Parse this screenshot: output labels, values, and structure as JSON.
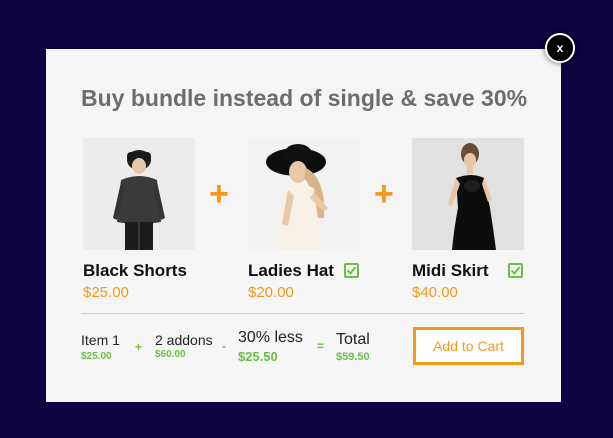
{
  "close_label": "x",
  "title": "Buy bundle instead of single & save 30%",
  "products": [
    {
      "name": "Black Shorts",
      "price": "$25.00",
      "checked": false
    },
    {
      "name": "Ladies Hat",
      "price": "$20.00",
      "checked": true
    },
    {
      "name": "Midi Skirt",
      "price": "$40.00",
      "checked": true
    }
  ],
  "plus_symbol": "+",
  "summary": {
    "item": {
      "label": "Item 1",
      "value": "$25.00"
    },
    "op1": "+",
    "addons": {
      "label": "2 addons",
      "value": "$60.00"
    },
    "op2": "-",
    "discount": {
      "label": "30% less",
      "value": "$25.50"
    },
    "op3": "=",
    "total": {
      "label": "Total",
      "value": "$59.50"
    }
  },
  "add_to_cart_label": "Add to Cart",
  "colors": {
    "accent": "#f39a1d",
    "green": "#6cc04a",
    "backdrop": "#0c0540"
  },
  "icons": {
    "close": "close-icon",
    "check": "check-icon",
    "plus": "plus-icon"
  }
}
